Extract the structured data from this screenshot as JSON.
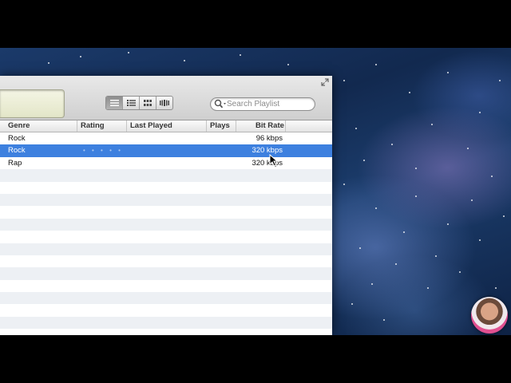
{
  "toolbar": {
    "search": {
      "placeholder": "Search Playlist",
      "value": ""
    },
    "view_buttons": [
      "list-view",
      "album-list-view",
      "grid-view",
      "cover-flow-view"
    ],
    "active_view": "list-view"
  },
  "table": {
    "columns": [
      "Genre",
      "Rating",
      "Last Played",
      "Plays",
      "Bit Rate"
    ],
    "rows": [
      {
        "genre": "Rock",
        "rating": "",
        "last_played": "",
        "plays": "",
        "bit_rate": "96 kbps",
        "selected": false
      },
      {
        "genre": "Rock",
        "rating": "• • • • •",
        "last_played": "",
        "plays": "",
        "bit_rate": "320 kbps",
        "selected": true
      },
      {
        "genre": "Rap",
        "rating": "",
        "last_played": "",
        "plays": "",
        "bit_rate": "320 kbps",
        "selected": false
      }
    ]
  },
  "colors": {
    "selection": "#3d80df",
    "stripe": "#edf0f4",
    "toolbar_top": "#e9e9e9",
    "toolbar_bottom": "#cfcfcf"
  },
  "icons": [
    "search-icon",
    "resize-icon",
    "cursor-icon"
  ]
}
